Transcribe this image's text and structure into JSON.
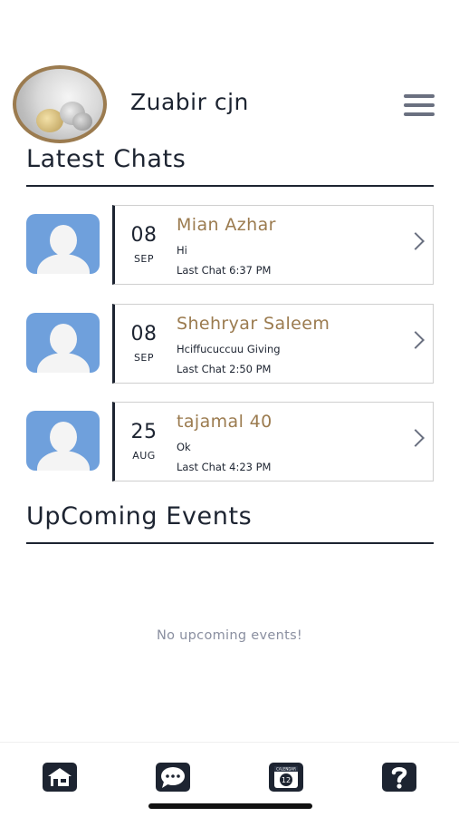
{
  "profile": {
    "name": "Zuabir cjn"
  },
  "sections": {
    "latest_chats": "Latest Chats",
    "upcoming_events": "UpComing Events"
  },
  "chats": [
    {
      "day": "08",
      "month": "SEP",
      "name": "Mian Azhar",
      "message": "Hi",
      "last": "Last Chat 6:37 PM"
    },
    {
      "day": "08",
      "month": "SEP",
      "name": "Shehryar Saleem",
      "message": "Hciffucuccuu Giving",
      "last": "Last Chat 2:50 PM"
    },
    {
      "day": "25",
      "month": "AUG",
      "name": "tajamal 40",
      "message": "Ok",
      "last": "Last Chat 4:23 PM"
    }
  ],
  "events": {
    "empty_text": "No upcoming events!"
  },
  "tabbar": {
    "calendar_label": "CALENDAR",
    "calendar_day": "12"
  },
  "colors": {
    "accent": "#9b7b4f",
    "dark": "#1d2431",
    "avatar_blue": "#6fa0dc"
  }
}
